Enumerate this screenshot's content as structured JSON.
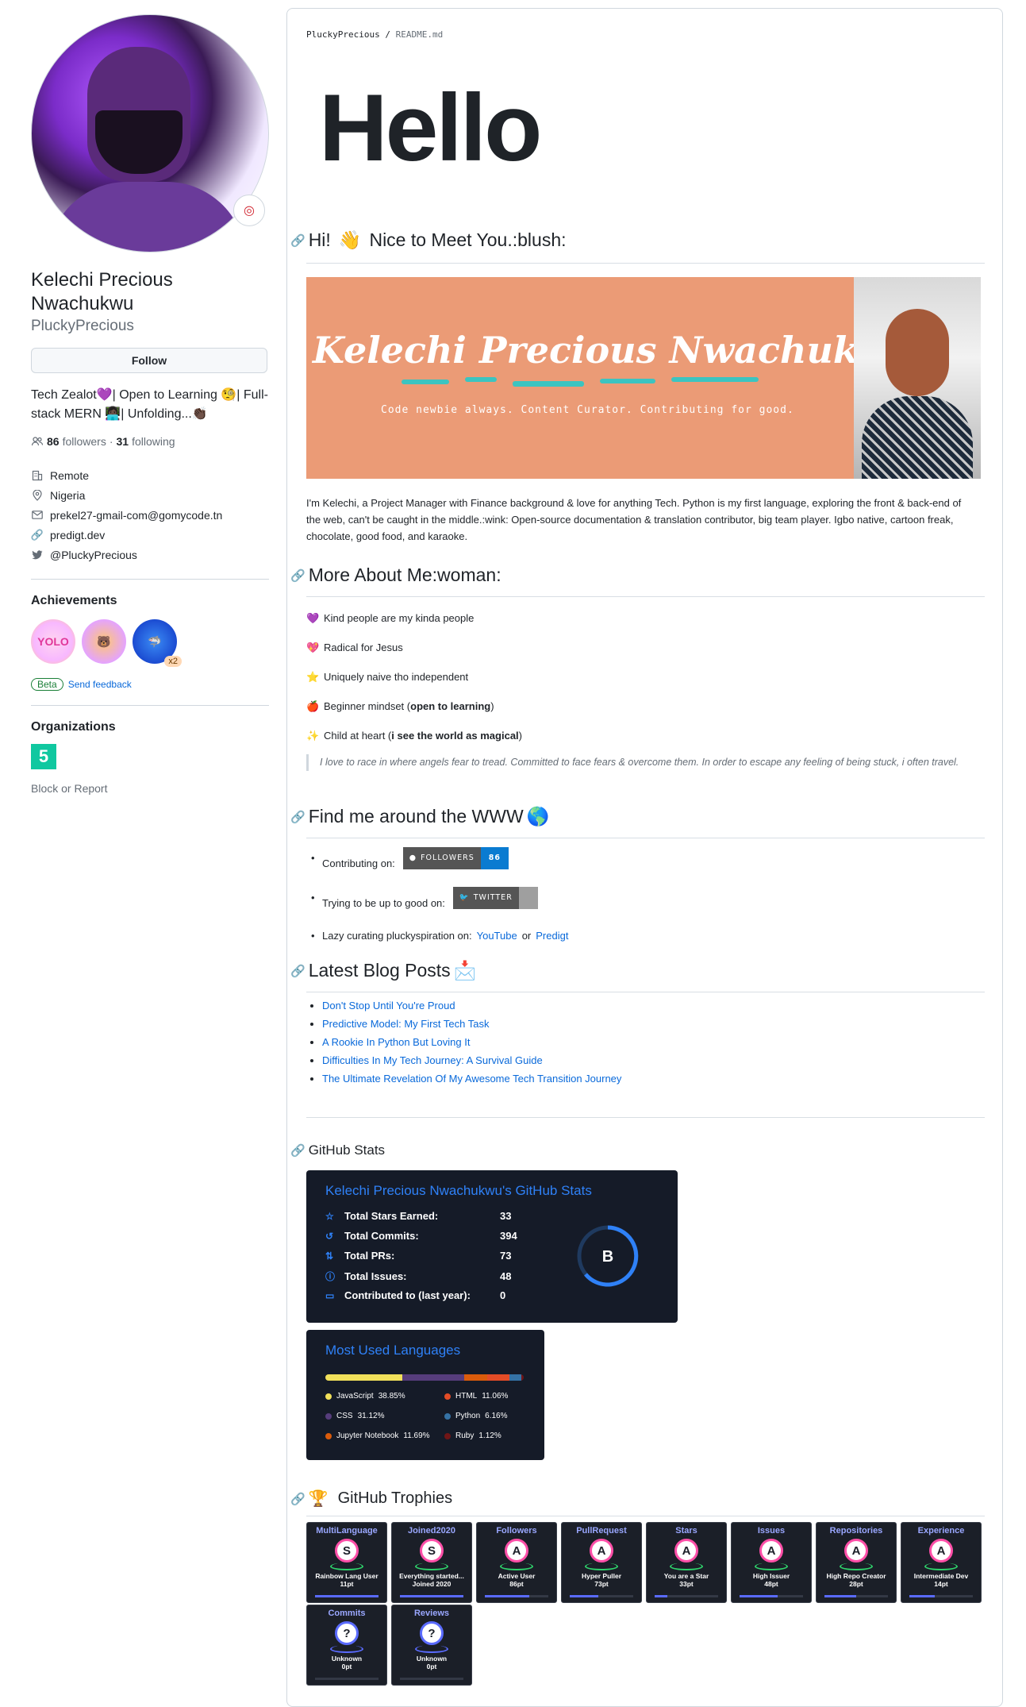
{
  "profile": {
    "full_name": "Kelechi Precious Nwachukwu",
    "login": "PluckyPrecious",
    "follow_label": "Follow",
    "bio": "Tech Zealot💜| Open to Learning 🧐| Full-stack MERN 👩🏿‍💻| Unfolding...👏🏿",
    "followers_count": "86",
    "followers_label": "followers",
    "following_count": "31",
    "following_label": "following",
    "separator": "·",
    "company": "Remote",
    "location": "Nigeria",
    "email": "prekel27-gmail-com@gomycode.tn",
    "website": "predigt.dev",
    "twitter": "@PluckyPrecious"
  },
  "achievements": {
    "title": "Achievements",
    "badges": [
      {
        "name": "yolo",
        "text": "YOLO"
      },
      {
        "name": "pull-shark-bear",
        "text": ""
      },
      {
        "name": "pull-shark",
        "text": "",
        "count": "x2"
      }
    ],
    "beta_label": "Beta",
    "feedback_label": "Send feedback"
  },
  "organizations": {
    "title": "Organizations",
    "block_label": "Block or Report"
  },
  "readme": {
    "breadcrumb_user": "PluckyPrecious",
    "breadcrumb_sep": "/",
    "breadcrumb_file": "README.md",
    "hello": "Hello",
    "greeting_prefix": "Hi!",
    "greeting_emoji": "👋",
    "greeting_suffix": "Nice to Meet You.:blush:",
    "banner_name": "Kelechi Precious Nwachukwu",
    "banner_tagline": "Code newbie always. Content Curator. Contributing for good.",
    "intro": "I'm Kelechi, a Project Manager with Finance background & love for anything Tech. Python is my first language, exploring the front & back-end of the web, can't be caught in the middle.:wink: Open-source documentation & translation contributor, big team player. Igbo native, cartoon freak, chocolate, good food, and karaoke.",
    "about_heading": "More About Me:woman:",
    "about_items": [
      {
        "emoji": "💜",
        "text": "Kind people are my kinda people",
        "bold": ""
      },
      {
        "emoji": "💖",
        "text": "Radical for Jesus",
        "bold": ""
      },
      {
        "emoji": "⭐",
        "text": "Uniquely naive tho independent",
        "bold": ""
      },
      {
        "emoji": "🍎",
        "text": "Beginner mindset (",
        "bold": "open to learning",
        "after": ")"
      },
      {
        "emoji": "✨",
        "text": "Child at heart (",
        "bold": "i see the world as magical",
        "after": ")"
      }
    ],
    "quote": "I love to race in where angels fear to tread. Committed to face fears & overcome them. In order to escape any feeling of being stuck, i often travel.",
    "find_heading": "Find me around the WWW",
    "find_emoji": "🌎",
    "contributing_label": "Contributing on:",
    "followers_badge_left": "FOLLOWERS",
    "followers_badge_right": "86",
    "twitter_label": "Trying to be up to good on:",
    "twitter_badge": "TWITTER",
    "lazy_label": "Lazy curating pluckyspiration on:",
    "youtube": "YouTube",
    "or": "or",
    "predigt": "Predigt",
    "blog_heading": "Latest Blog Posts",
    "blog_emoji": "📩",
    "blog_posts": [
      "Don't Stop Until You're Proud",
      "Predictive Model: My First Tech Task",
      "A Rookie In Python But Loving It",
      "Difficulties In My Tech Journey: A Survival Guide",
      "The Ultimate Revelation Of My Awesome Tech Transition Journey"
    ],
    "stats_heading": "GitHub Stats",
    "trophies_heading": "GitHub Trophies",
    "trophies_emoji": "🏆"
  },
  "stats_card": {
    "title": "Kelechi Precious Nwachukwu's GitHub Stats",
    "rows": [
      {
        "label": "Total Stars Earned:",
        "value": "33",
        "icon": "star-icon"
      },
      {
        "label": "Total Commits:",
        "value": "394",
        "icon": "history-icon"
      },
      {
        "label": "Total PRs:",
        "value": "73",
        "icon": "pr-icon"
      },
      {
        "label": "Total Issues:",
        "value": "48",
        "icon": "issue-icon"
      },
      {
        "label": "Contributed to (last year):",
        "value": "0",
        "icon": "repo-icon"
      }
    ],
    "rank": "B",
    "accent": "#2f81f7"
  },
  "lang_card": {
    "title": "Most Used Languages",
    "languages": [
      {
        "name": "JavaScript",
        "pct": "38.85%",
        "value": 38.85,
        "color": "#f1e05a"
      },
      {
        "name": "HTML",
        "pct": "11.06%",
        "value": 11.06,
        "color": "#e34c26"
      },
      {
        "name": "CSS",
        "pct": "31.12%",
        "value": 31.12,
        "color": "#563d7c"
      },
      {
        "name": "Python",
        "pct": "6.16%",
        "value": 6.16,
        "color": "#3572A5"
      },
      {
        "name": "Jupyter Notebook",
        "pct": "11.69%",
        "value": 11.69,
        "color": "#DA5B0B"
      },
      {
        "name": "Ruby",
        "pct": "1.12%",
        "value": 1.12,
        "color": "#701516"
      }
    ]
  },
  "trophies": [
    {
      "category": "MultiLanguage",
      "rank": "S",
      "title": "Rainbow Lang User",
      "points": "11pt",
      "progress": 1.0
    },
    {
      "category": "Joined2020",
      "rank": "S",
      "title": "Everything started...",
      "sub": "Joined 2020",
      "points": "",
      "progress": 1.0
    },
    {
      "category": "Followers",
      "rank": "A",
      "title": "Active User",
      "points": "86pt",
      "progress": 0.7
    },
    {
      "category": "PullRequest",
      "rank": "A",
      "title": "Hyper Puller",
      "points": "73pt",
      "progress": 0.45
    },
    {
      "category": "Stars",
      "rank": "A",
      "title": "You are a Star",
      "points": "33pt",
      "progress": 0.2
    },
    {
      "category": "Issues",
      "rank": "A",
      "title": "High Issuer",
      "points": "48pt",
      "progress": 0.6
    },
    {
      "category": "Repositories",
      "rank": "A",
      "title": "High Repo Creator",
      "points": "28pt",
      "progress": 0.5
    },
    {
      "category": "Experience",
      "rank": "A",
      "title": "Intermediate Dev",
      "points": "14pt",
      "progress": 0.4
    },
    {
      "category": "Commits",
      "rank": "?",
      "title": "Unknown",
      "points": "0pt",
      "progress": 0.0
    },
    {
      "category": "Reviews",
      "rank": "?",
      "title": "Unknown",
      "points": "0pt",
      "progress": 0.0
    }
  ]
}
